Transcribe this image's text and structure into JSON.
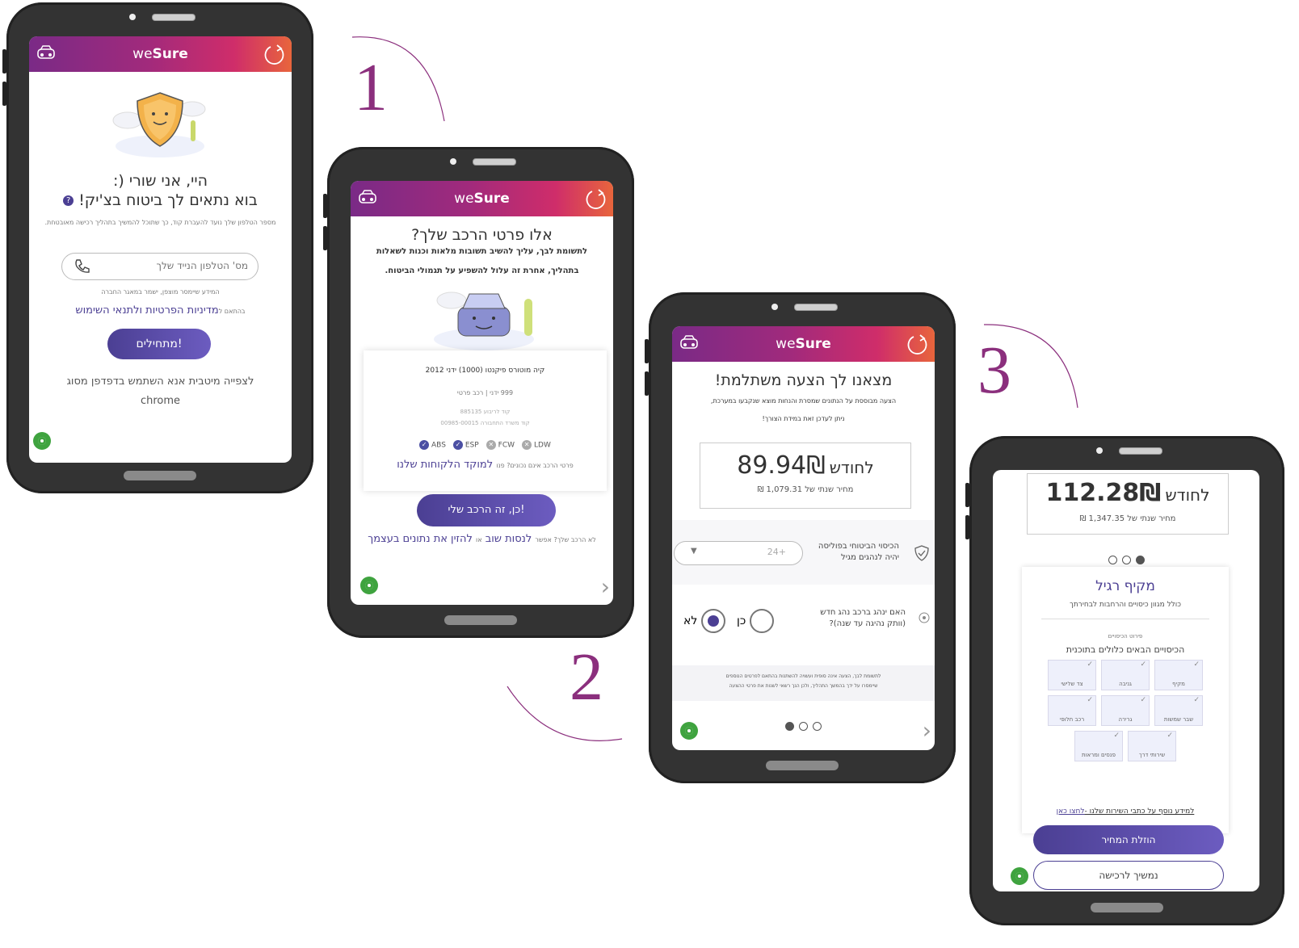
{
  "brand": {
    "logo_prefix": "we",
    "logo_bold": "Sure"
  },
  "steps": {
    "one": "1",
    "two": "2",
    "three": "3"
  },
  "screen1": {
    "greeting": "היי, אני שורי (:",
    "title": "בוא נתאים לך ביטוח בצ'יק!",
    "help_icon": "question-icon",
    "intro": "מספר הטלפון שלך נועד להעברת קוד, כך שתוכל להמשיך בתהליך רכישה מאובטחת.",
    "phone_placeholder": "מס' הטלפון הנייד שלך",
    "privacy_note": "המידע שיימסר מוצפן, ישמר במאגר החברה",
    "terms_prefix": "בהתאם ל",
    "terms_link": "מדיניות הפרטיות ולתנאי השימוש",
    "start_button": "מתחילים!",
    "browser_note": "לצפייה מיטבית אנא השתמש בדפדפן מסוג chrome"
  },
  "screen2": {
    "title": "אלו פרטי הרכב שלך?",
    "note_line1": "לתשומת לבך, עליך להשיב תשובות מלאות וכנות לשאלות",
    "note_line2": "בתהליך, אחרת זה עלול להשפיע על תגמולי הביטוח.",
    "car_model": "קיה מוטורס פיקנטו (1000) ידני 2012",
    "car_details": "999 ידני | רכב פרטי",
    "license_code": "קוד לריבוע 885135",
    "ministry_code": "קוד משרד התחבורה 00985-00015",
    "features": [
      {
        "label": "ABS",
        "on": true
      },
      {
        "label": "ESP",
        "on": true
      },
      {
        "label": "FCW",
        "on": false
      },
      {
        "label": "LDW",
        "on": false
      }
    ],
    "wrong_details_prefix": "פרטי הרכב אינם נכונים? פנו",
    "wrong_details_link": "למוקד הלקוחות שלנו",
    "confirm_button": "כן, זה הרכב שלי!",
    "not_my_car_prefix": "לא הרכב שלך? אפשר",
    "try_again_link": "לנסות שוב",
    "or": "או",
    "manual_link": "להזין את נתונים בעצמך"
  },
  "screen3": {
    "title": "מצאנו לך הצעה משתלמת!",
    "desc_line1": "הצעה מבוססת על הנתונים שמסרת והנחות מוצא שנקבעו במערכת,",
    "desc_line2": "ניתן לעדכן זאת במידת הצורך!",
    "price": "89.94₪",
    "per_month": "לחודש",
    "annual": "מחיר שנתי של 1,079.31 ₪",
    "coverage_label_1": "הכיסוי הביטוחי בפוליסה",
    "coverage_label_2": "יהיה לנהגים מגיל",
    "age_value": "24+",
    "new_driver_1": "האם ינהג ברכב נהג חדש",
    "new_driver_2": "(וותק נהיגה עד שנה)?",
    "yes": "כן",
    "no": "לא",
    "footnote_1": "לתשומת לבך, הצעה אינה סופית ועשויה להשתנות בהתאם לפרטים הנוספים",
    "footnote_2": "שיימסרו על ידך בהמשך התהליך, ולכן הנך רשאי לשנות את פרטי ההצעה"
  },
  "screen4": {
    "price": "112.28₪",
    "per_month": "לחודש",
    "annual": "מחיר שנתי של 1,347.35 ₪",
    "plan_title": "מקיף רגיל",
    "plan_subtitle": "כולל מגוון כיסויים והרחבות לבחירתך",
    "covers_small": "פירוט הכיסויים",
    "covers_heading": "הכיסויים הבאים כלולים בתוכנית",
    "tiles": [
      "צד שלישי",
      "גניבה",
      "מקיף",
      "רכב חלופי",
      "גרירה",
      "שבר שמשות",
      "פנסים ומראות",
      "שירותי דרך"
    ],
    "info_prefix": "למידע נוסף על כתבי השירות שלנו -",
    "info_link": "לחצו כאן",
    "lower_price_button": "הוזלת המחיר",
    "continue_button": "נמשיך לרכישה"
  }
}
